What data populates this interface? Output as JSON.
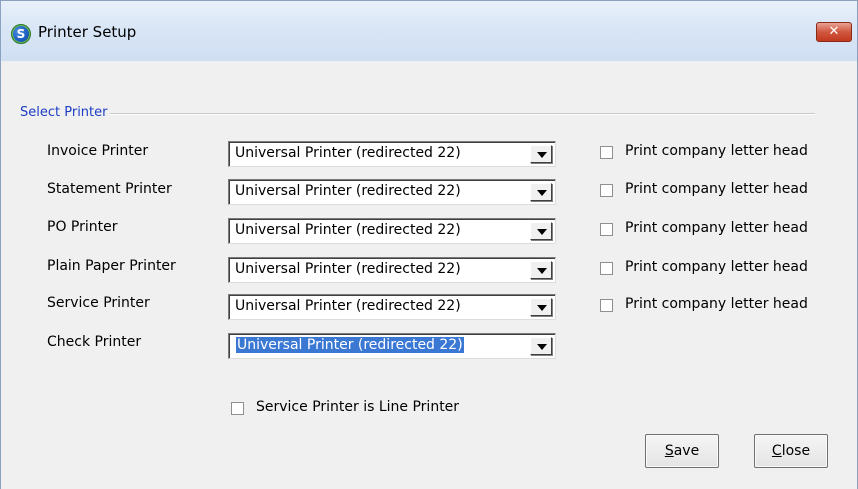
{
  "window": {
    "title": "Printer Setup",
    "icon": "s-app-icon",
    "icon_glyph": "S",
    "close_glyph": "✕"
  },
  "group": {
    "label": "Select Printer"
  },
  "printers": [
    {
      "label": "Invoice Printer",
      "value": "Universal Printer  (redirected 22)",
      "letterhead_label": "Print company letter head",
      "letterhead_checked": false
    },
    {
      "label": "Statement Printer",
      "value": "Universal Printer  (redirected 22)",
      "letterhead_label": "Print company letter head",
      "letterhead_checked": false
    },
    {
      "label": "PO Printer",
      "value": "Universal Printer  (redirected 22)",
      "letterhead_label": "Print company letter head",
      "letterhead_checked": false
    },
    {
      "label": "Plain Paper Printer",
      "value": "Universal Printer  (redirected 22)",
      "letterhead_label": "Print company letter head",
      "letterhead_checked": false
    },
    {
      "label": "Service Printer",
      "value": "Universal Printer  (redirected 22)",
      "letterhead_label": "Print company letter head",
      "letterhead_checked": false
    },
    {
      "label": "Check Printer",
      "value": "Universal Printer  (redirected 22)",
      "selected": true
    }
  ],
  "line_printer": {
    "label": "Service Printer is Line Printer",
    "checked": false
  },
  "buttons": {
    "save_mnemonic": "S",
    "save_rest": "ave",
    "close_mnemonic": "C",
    "close_rest": "lose"
  },
  "colors": {
    "group_label": "#1e3cc4",
    "selection": "#3a78d4",
    "close_button": "#c2391f"
  }
}
